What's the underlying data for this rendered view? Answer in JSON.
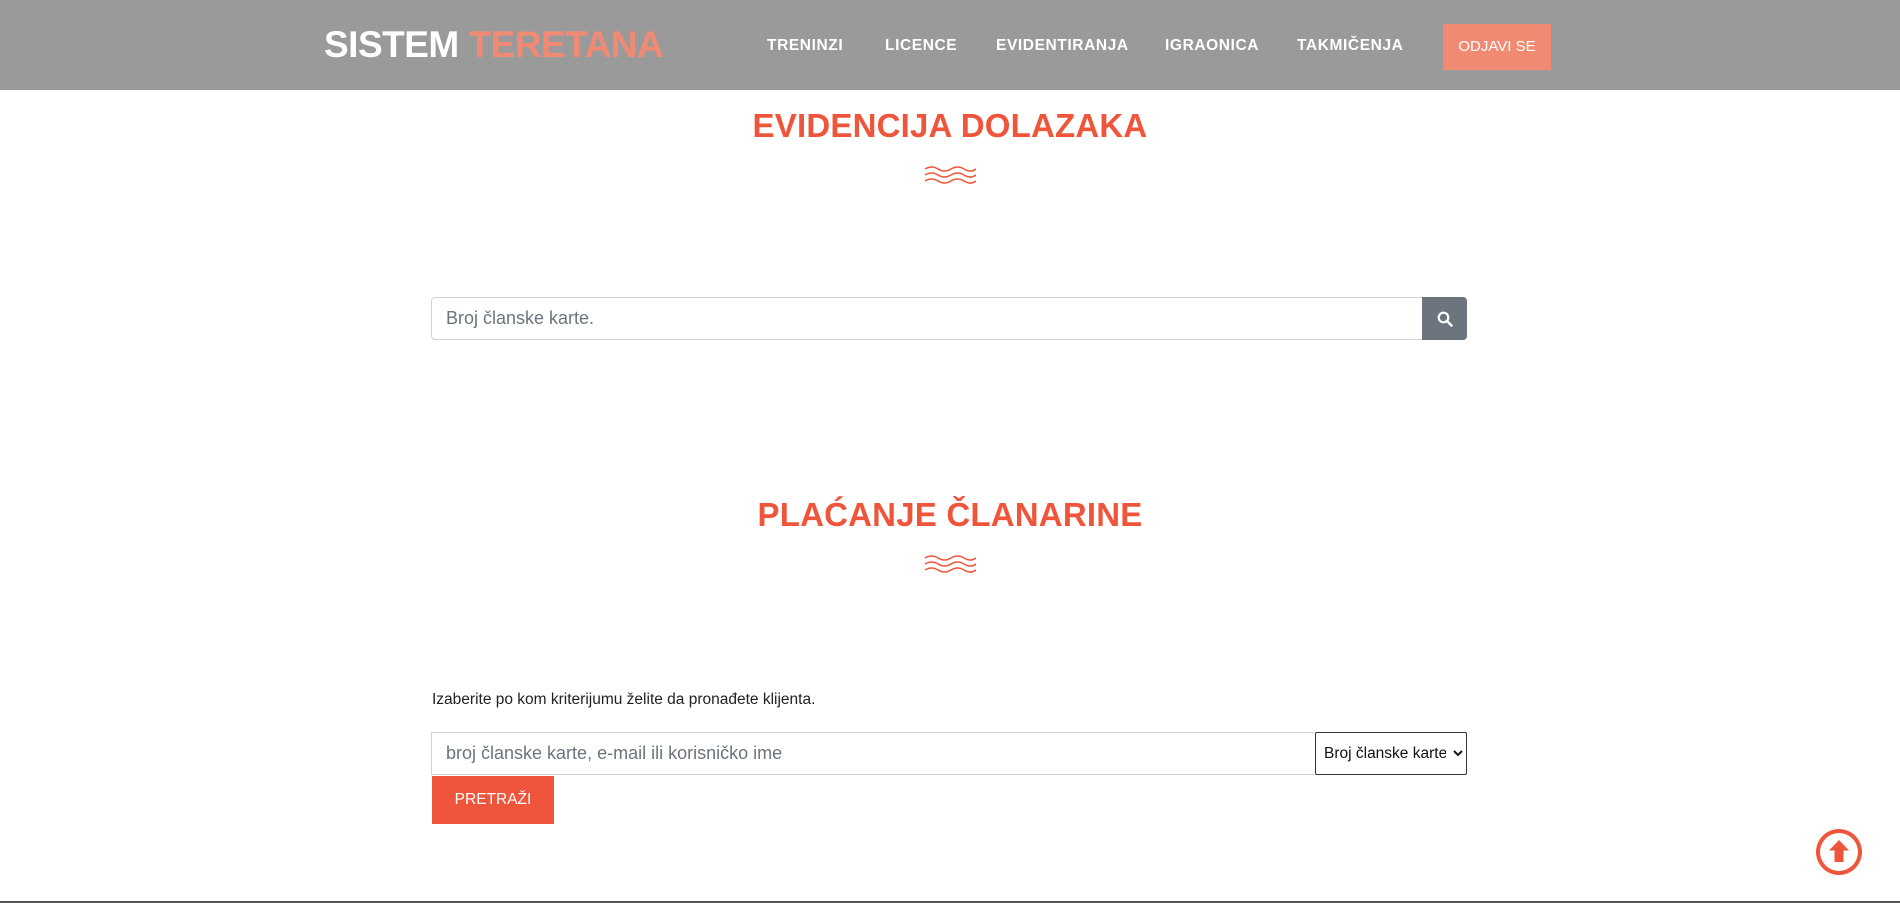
{
  "header": {
    "logo_part1": "SISTEM",
    "logo_part2": "TERETANA",
    "nav": [
      {
        "label": "TRENINZI"
      },
      {
        "label": "LICENCE"
      },
      {
        "label": "EVIDENTIRANJA"
      },
      {
        "label": "IGRAONICA"
      },
      {
        "label": "TAKMIČENJA"
      }
    ],
    "logout_label": "ODJAVI SE"
  },
  "attendance": {
    "title": "EVIDENCIJA DOLAZAKA",
    "search_placeholder": "Broj članske karte.",
    "search_value": "",
    "search_button_icon": "search-icon"
  },
  "payment": {
    "title": "PLAĆANJE ČLANARINE",
    "helper_text": "Izaberite po kom kriterijumu želite da pronađete klijenta.",
    "client_placeholder": "broj članske karte, e-mail ili korisničko ime",
    "client_value": "",
    "criteria_selected": "Broj članske karte",
    "search_label": "PRETRAŽI"
  },
  "scroll_top_icon": "arrow-up-circle-icon",
  "colors": {
    "accent": "#ef553a",
    "accent_light": "#f18a73",
    "header_bg": "#9a9a9a",
    "search_button_bg": "#6c757d"
  }
}
